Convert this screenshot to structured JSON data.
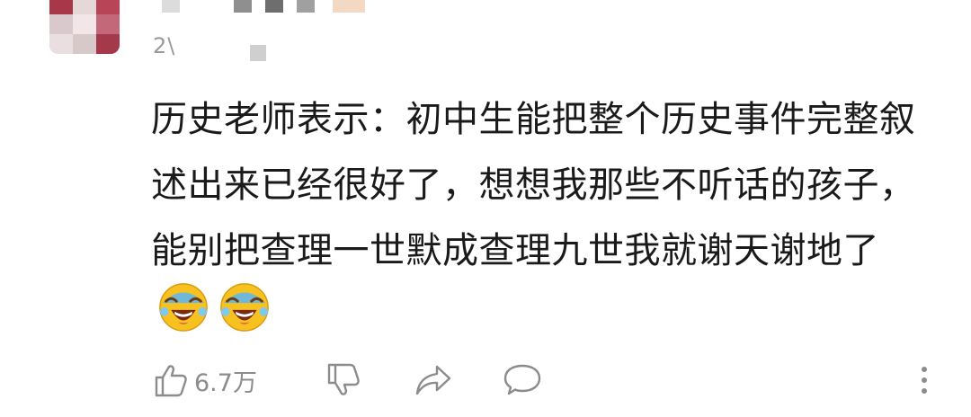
{
  "comment": {
    "timestamp": "2\\",
    "text_lines": [
      "历史老师表示：初中生能把整个历史事件完整叙",
      "述出来已经很好了，想想我那些不听话的孩子，",
      "能别把查理一世默成查理九世我就谢天谢地了"
    ],
    "emojis": [
      "laugh-cry-icon",
      "laugh-cry-icon"
    ]
  },
  "actions": {
    "like_count": "6.7万",
    "icons": [
      "thumbs-up-icon",
      "thumbs-down-icon",
      "share-icon",
      "comment-icon",
      "more-icon"
    ]
  },
  "colors": {
    "text": "#1a1a1a",
    "secondary": "#8c8c8c",
    "icon": "#8c8c8c",
    "emoji_yellow": "#f7c21f"
  }
}
